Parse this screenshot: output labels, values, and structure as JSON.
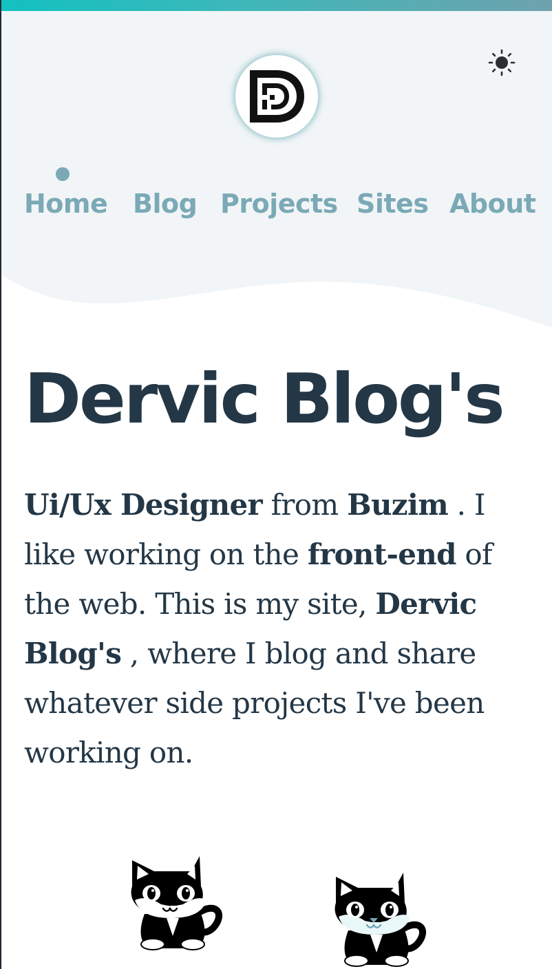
{
  "theme": {
    "accent": "#7ba9b6",
    "text": "#243746",
    "header_bg": "#f1f5f7",
    "gradient_start": "#13c1c1",
    "gradient_end": "#6ea2ad"
  },
  "header": {
    "theme_toggle_icon": "sun-icon",
    "logo_icon": "dd-monogram-logo"
  },
  "nav": {
    "active": "Home",
    "items": [
      {
        "label": "Home"
      },
      {
        "label": "Blog"
      },
      {
        "label": "Projects"
      },
      {
        "label": "Sites"
      },
      {
        "label": "About"
      }
    ]
  },
  "main": {
    "title": "Dervic Blog's",
    "bio": {
      "role": "Ui/Ux Designer",
      "t1": " from ",
      "place": "Buzim",
      "t2": " . I like working on the ",
      "focus": "front-end",
      "t3": " of the web. This is my site, ",
      "site_name": "Dervic Blog's",
      "t4": " , where I blog and share whatever side projects I've been working on."
    }
  },
  "illustrations": {
    "left_icon": "cat-mascot-icon",
    "right_icon": "cat-mascot-icon"
  }
}
